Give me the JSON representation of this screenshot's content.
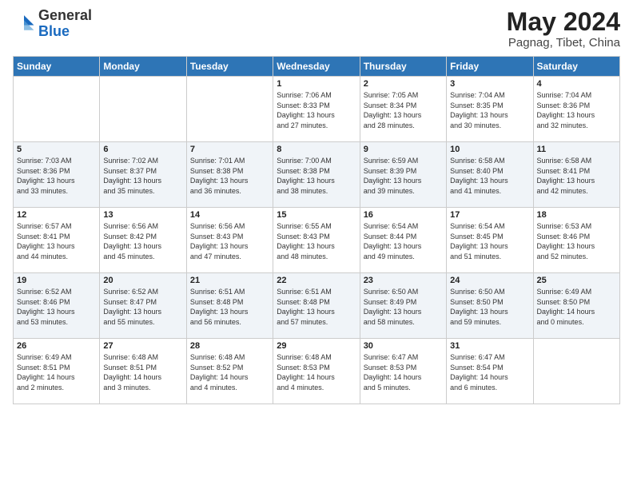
{
  "header": {
    "logo_general": "General",
    "logo_blue": "Blue",
    "month_title": "May 2024",
    "location": "Pagnag, Tibet, China"
  },
  "weekdays": [
    "Sunday",
    "Monday",
    "Tuesday",
    "Wednesday",
    "Thursday",
    "Friday",
    "Saturday"
  ],
  "rows": [
    [
      {
        "day": "",
        "text": ""
      },
      {
        "day": "",
        "text": ""
      },
      {
        "day": "",
        "text": ""
      },
      {
        "day": "1",
        "text": "Sunrise: 7:06 AM\nSunset: 8:33 PM\nDaylight: 13 hours\nand 27 minutes."
      },
      {
        "day": "2",
        "text": "Sunrise: 7:05 AM\nSunset: 8:34 PM\nDaylight: 13 hours\nand 28 minutes."
      },
      {
        "day": "3",
        "text": "Sunrise: 7:04 AM\nSunset: 8:35 PM\nDaylight: 13 hours\nand 30 minutes."
      },
      {
        "day": "4",
        "text": "Sunrise: 7:04 AM\nSunset: 8:36 PM\nDaylight: 13 hours\nand 32 minutes."
      }
    ],
    [
      {
        "day": "5",
        "text": "Sunrise: 7:03 AM\nSunset: 8:36 PM\nDaylight: 13 hours\nand 33 minutes."
      },
      {
        "day": "6",
        "text": "Sunrise: 7:02 AM\nSunset: 8:37 PM\nDaylight: 13 hours\nand 35 minutes."
      },
      {
        "day": "7",
        "text": "Sunrise: 7:01 AM\nSunset: 8:38 PM\nDaylight: 13 hours\nand 36 minutes."
      },
      {
        "day": "8",
        "text": "Sunrise: 7:00 AM\nSunset: 8:38 PM\nDaylight: 13 hours\nand 38 minutes."
      },
      {
        "day": "9",
        "text": "Sunrise: 6:59 AM\nSunset: 8:39 PM\nDaylight: 13 hours\nand 39 minutes."
      },
      {
        "day": "10",
        "text": "Sunrise: 6:58 AM\nSunset: 8:40 PM\nDaylight: 13 hours\nand 41 minutes."
      },
      {
        "day": "11",
        "text": "Sunrise: 6:58 AM\nSunset: 8:41 PM\nDaylight: 13 hours\nand 42 minutes."
      }
    ],
    [
      {
        "day": "12",
        "text": "Sunrise: 6:57 AM\nSunset: 8:41 PM\nDaylight: 13 hours\nand 44 minutes."
      },
      {
        "day": "13",
        "text": "Sunrise: 6:56 AM\nSunset: 8:42 PM\nDaylight: 13 hours\nand 45 minutes."
      },
      {
        "day": "14",
        "text": "Sunrise: 6:56 AM\nSunset: 8:43 PM\nDaylight: 13 hours\nand 47 minutes."
      },
      {
        "day": "15",
        "text": "Sunrise: 6:55 AM\nSunset: 8:43 PM\nDaylight: 13 hours\nand 48 minutes."
      },
      {
        "day": "16",
        "text": "Sunrise: 6:54 AM\nSunset: 8:44 PM\nDaylight: 13 hours\nand 49 minutes."
      },
      {
        "day": "17",
        "text": "Sunrise: 6:54 AM\nSunset: 8:45 PM\nDaylight: 13 hours\nand 51 minutes."
      },
      {
        "day": "18",
        "text": "Sunrise: 6:53 AM\nSunset: 8:46 PM\nDaylight: 13 hours\nand 52 minutes."
      }
    ],
    [
      {
        "day": "19",
        "text": "Sunrise: 6:52 AM\nSunset: 8:46 PM\nDaylight: 13 hours\nand 53 minutes."
      },
      {
        "day": "20",
        "text": "Sunrise: 6:52 AM\nSunset: 8:47 PM\nDaylight: 13 hours\nand 55 minutes."
      },
      {
        "day": "21",
        "text": "Sunrise: 6:51 AM\nSunset: 8:48 PM\nDaylight: 13 hours\nand 56 minutes."
      },
      {
        "day": "22",
        "text": "Sunrise: 6:51 AM\nSunset: 8:48 PM\nDaylight: 13 hours\nand 57 minutes."
      },
      {
        "day": "23",
        "text": "Sunrise: 6:50 AM\nSunset: 8:49 PM\nDaylight: 13 hours\nand 58 minutes."
      },
      {
        "day": "24",
        "text": "Sunrise: 6:50 AM\nSunset: 8:50 PM\nDaylight: 13 hours\nand 59 minutes."
      },
      {
        "day": "25",
        "text": "Sunrise: 6:49 AM\nSunset: 8:50 PM\nDaylight: 14 hours\nand 0 minutes."
      }
    ],
    [
      {
        "day": "26",
        "text": "Sunrise: 6:49 AM\nSunset: 8:51 PM\nDaylight: 14 hours\nand 2 minutes."
      },
      {
        "day": "27",
        "text": "Sunrise: 6:48 AM\nSunset: 8:51 PM\nDaylight: 14 hours\nand 3 minutes."
      },
      {
        "day": "28",
        "text": "Sunrise: 6:48 AM\nSunset: 8:52 PM\nDaylight: 14 hours\nand 4 minutes."
      },
      {
        "day": "29",
        "text": "Sunrise: 6:48 AM\nSunset: 8:53 PM\nDaylight: 14 hours\nand 4 minutes."
      },
      {
        "day": "30",
        "text": "Sunrise: 6:47 AM\nSunset: 8:53 PM\nDaylight: 14 hours\nand 5 minutes."
      },
      {
        "day": "31",
        "text": "Sunrise: 6:47 AM\nSunset: 8:54 PM\nDaylight: 14 hours\nand 6 minutes."
      },
      {
        "day": "",
        "text": ""
      }
    ]
  ]
}
